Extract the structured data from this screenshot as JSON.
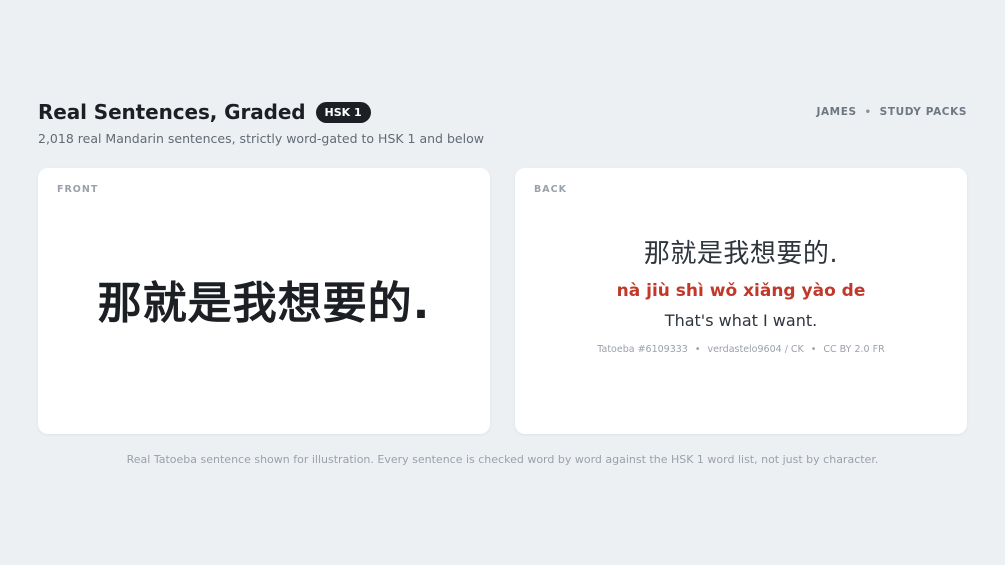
{
  "header": {
    "title": "Real Sentences, Graded",
    "badge": "HSK 1",
    "subtitle": "2,018 real Mandarin sentences, strictly word-gated to HSK 1 and below"
  },
  "nav": {
    "user": "JAMES",
    "separator": "•",
    "study_packs": "STUDY PACKS"
  },
  "front_card": {
    "label": "FRONT",
    "hanzi": "那就是我想要的."
  },
  "back_card": {
    "label": "BACK",
    "hanzi": "那就是我想要的.",
    "pinyin": "nà jiù shì wǒ xiǎng yào de",
    "english": "That's what I want.",
    "meta": {
      "source": "Tatoeba #6109333",
      "separator": "•",
      "author": "verdastelo9604 / CK",
      "license": "CC BY 2.0 FR"
    }
  },
  "footer": {
    "note": "Real Tatoeba sentence shown for illustration. Every sentence is checked word by word against the HSK 1 word list, not just by character."
  },
  "colors": {
    "background": "#edf0f3",
    "card": "#ffffff",
    "badge": "#1c1f24",
    "pinyin": "#c0392b"
  }
}
